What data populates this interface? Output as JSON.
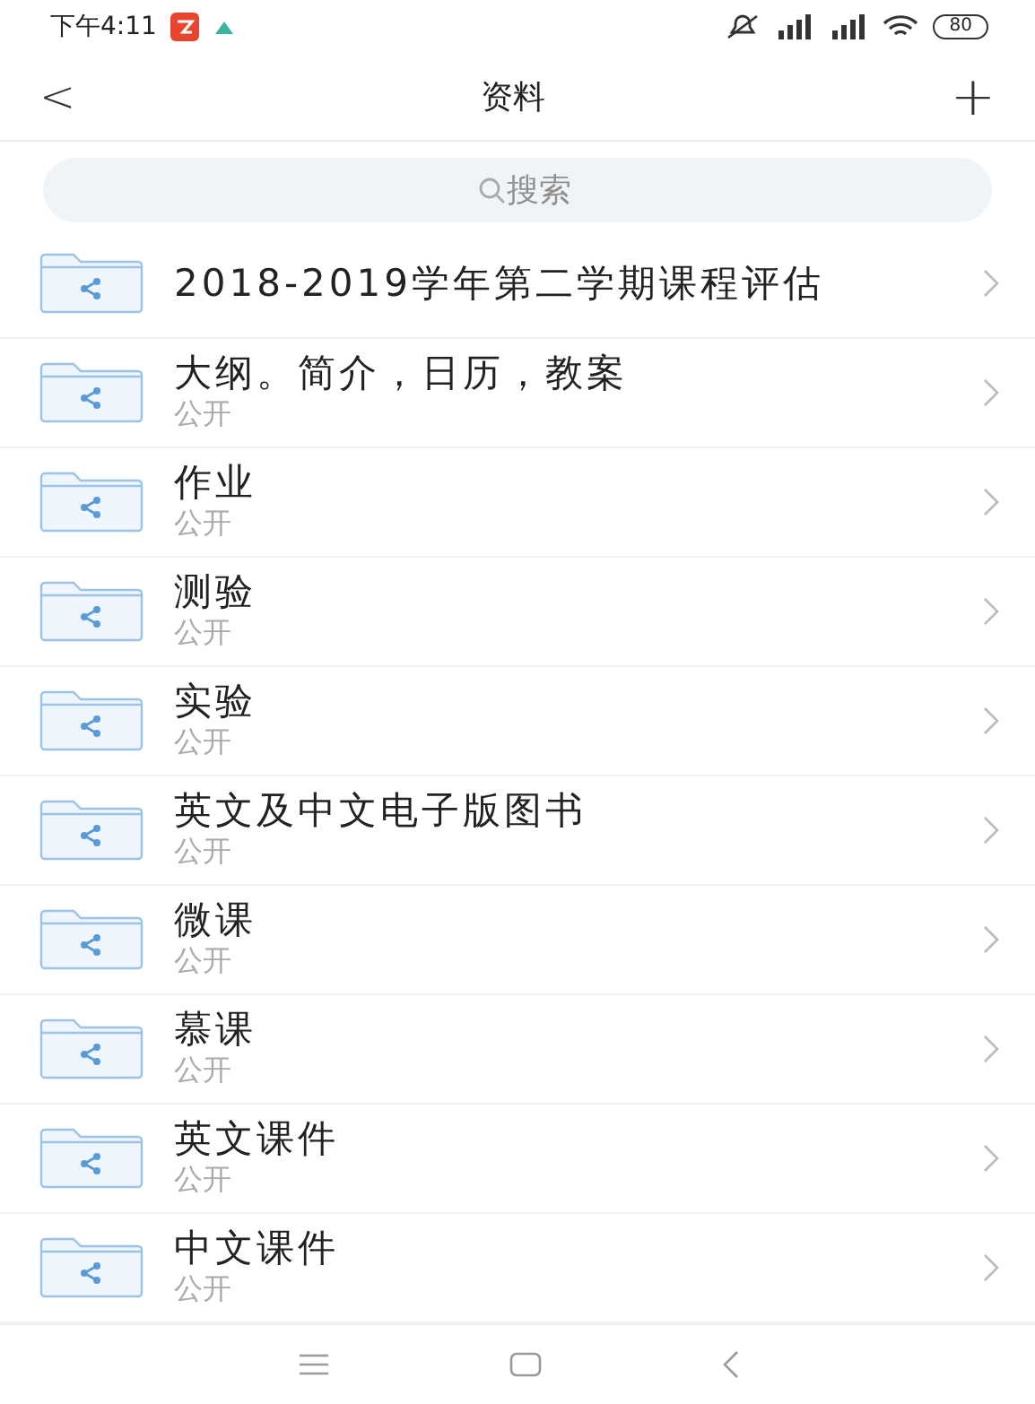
{
  "status_bar": {
    "time": "下午4:11",
    "battery": "80"
  },
  "nav": {
    "back": "<",
    "title": "资料",
    "add": "+"
  },
  "search": {
    "placeholder": "搜索"
  },
  "folders": [
    {
      "title": "2018-2019学年第二学期课程评估"
    },
    {
      "title": "大纲。简介，日历，教案",
      "subtitle": "公开"
    },
    {
      "title": "作业",
      "subtitle": "公开"
    },
    {
      "title": "测验",
      "subtitle": "公开"
    },
    {
      "title": "实验",
      "subtitle": "公开"
    },
    {
      "title": "英文及中文电子版图书",
      "subtitle": "公开"
    },
    {
      "title": "微课",
      "subtitle": "公开"
    },
    {
      "title": "慕课",
      "subtitle": "公开"
    },
    {
      "title": "英文课件",
      "subtitle": "公开"
    },
    {
      "title": "中文课件",
      "subtitle": "公开"
    }
  ]
}
